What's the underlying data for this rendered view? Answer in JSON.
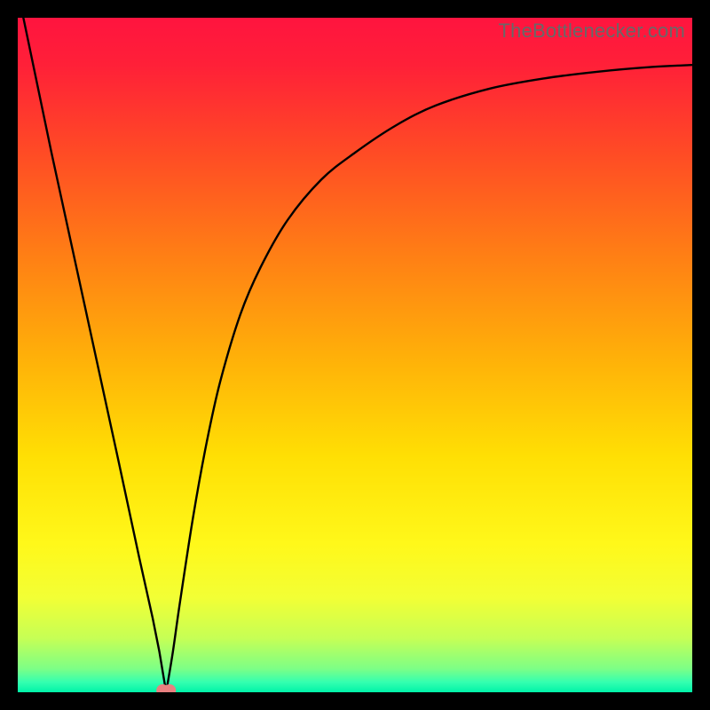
{
  "watermark": "TheBottlenecker.com",
  "chart_data": {
    "type": "line",
    "title": "",
    "xlabel": "",
    "ylabel": "",
    "xlim": [
      0,
      100
    ],
    "ylim": [
      0,
      100
    ],
    "x_min_at_valley": 22,
    "gradient_stops": [
      {
        "offset": 0.0,
        "color": "#ff143f"
      },
      {
        "offset": 0.07,
        "color": "#ff2038"
      },
      {
        "offset": 0.2,
        "color": "#ff4b25"
      },
      {
        "offset": 0.35,
        "color": "#ff7e15"
      },
      {
        "offset": 0.5,
        "color": "#ffaf09"
      },
      {
        "offset": 0.65,
        "color": "#ffdf04"
      },
      {
        "offset": 0.78,
        "color": "#fff81a"
      },
      {
        "offset": 0.86,
        "color": "#f2ff35"
      },
      {
        "offset": 0.92,
        "color": "#c6ff55"
      },
      {
        "offset": 0.965,
        "color": "#7dff86"
      },
      {
        "offset": 0.985,
        "color": "#34ffb0"
      },
      {
        "offset": 1.0,
        "color": "#00f3a8"
      }
    ],
    "series": [
      {
        "name": "curve",
        "x": [
          0,
          5,
          10,
          15,
          18,
          20,
          21,
          22,
          23,
          24,
          26,
          28,
          30,
          33,
          36,
          40,
          45,
          50,
          56,
          62,
          70,
          78,
          86,
          94,
          100
        ],
        "y": [
          104,
          80,
          57,
          34,
          20,
          11,
          6,
          0,
          6,
          13,
          26,
          37,
          46,
          56,
          63,
          70,
          76,
          80,
          84,
          87,
          89.5,
          91,
          92,
          92.7,
          93
        ]
      }
    ],
    "marker": {
      "x": 22,
      "y": 0,
      "color": "#e88080",
      "radius": 7
    }
  }
}
